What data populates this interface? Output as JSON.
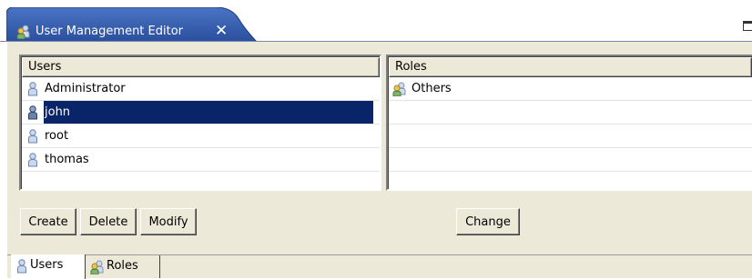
{
  "editor": {
    "tab_title": "User Management Editor",
    "tab_icon": "users-group-icon",
    "close_glyph": "✕"
  },
  "users_table": {
    "header": "Users",
    "rows": [
      {
        "label": "Administrator",
        "icon": "user-icon",
        "selected": false
      },
      {
        "label": "john",
        "icon": "user-icon",
        "selected": true
      },
      {
        "label": "root",
        "icon": "user-icon",
        "selected": false
      },
      {
        "label": "thomas",
        "icon": "user-icon",
        "selected": false
      }
    ]
  },
  "roles_table": {
    "header": "Roles",
    "rows": [
      {
        "label": "Others",
        "icon": "role-group-icon"
      }
    ]
  },
  "buttons": {
    "create": "Create",
    "delete": "Delete",
    "modify": "Modify",
    "change": "Change"
  },
  "bottom_tabs": [
    {
      "label": "Users",
      "icon": "user-icon",
      "active": true
    },
    {
      "label": "Roles",
      "icon": "role-group-icon",
      "active": false
    }
  ],
  "colors": {
    "tab_active": "#2f56a8",
    "selection": "#0a246a",
    "panel_bg": "#ece9d8"
  }
}
